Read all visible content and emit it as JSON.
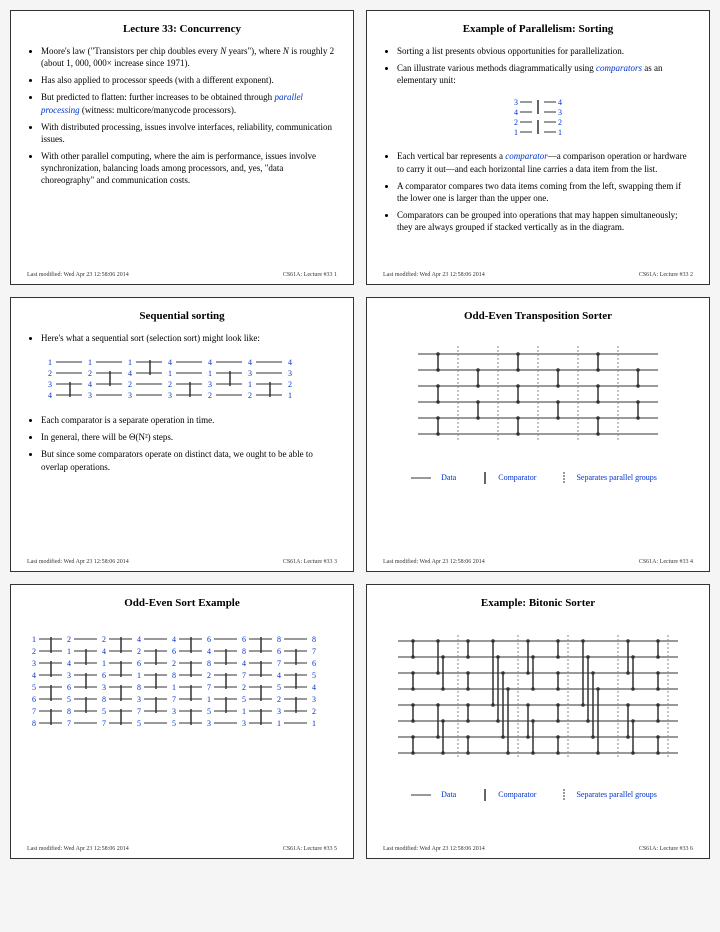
{
  "slides": [
    {
      "title": "Lecture 33: Concurrency",
      "footer_left": "Last modified: Wed Apr 23 12:58:06 2014",
      "footer_right": "CS61A: Lecture #33   1"
    },
    {
      "title": "Example of Parallelism: Sorting",
      "footer_left": "Last modified: Wed Apr 23 12:58:06 2014",
      "footer_right": "CS61A: Lecture #33   2"
    },
    {
      "title": "Sequential sorting",
      "footer_left": "Last modified: Wed Apr 23 12:58:06 2014",
      "footer_right": "CS61A: Lecture #33   3"
    },
    {
      "title": "Odd-Even Transposition Sorter",
      "footer_left": "Last modified: Wed Apr 23 12:58:06 2014",
      "footer_right": "CS61A: Lecture #33   4"
    },
    {
      "title": "Odd-Even Sort Example",
      "footer_left": "Last modified: Wed Apr 23 12:58:06 2014",
      "footer_right": "CS61A: Lecture #33   5"
    },
    {
      "title": "Example: Bitonic Sorter",
      "footer_left": "Last modified: Wed Apr 23 12:58:06 2014",
      "footer_right": "CS61A: Lecture #33   6"
    }
  ],
  "s1": {
    "b1a": "Moore's law (\"Transistors per chip doubles every ",
    "b1b": " years\"), where ",
    "b1c": " is roughly 2 (about ",
    "b1d": " increase since 1971).",
    "n1": "N",
    "n2": "N",
    "million": "1, 000, 000×",
    "b2": "Has also applied to processor speeds (with a different exponent).",
    "b3a": "But predicted to flatten: further increases to be obtained through ",
    "b3b": " (witness: multicore/manycode processors).",
    "link1": "parallel processing",
    "b4": "With distributed processing, issues involve interfaces, reliability, communication issues.",
    "b5": "With other parallel computing, where the aim is performance, issues involve synchronization, balancing loads among processors, and, yes, \"data choreography\" and communication costs."
  },
  "s2": {
    "b1": "Sorting a list presents obvious opportunities for parallelization.",
    "b2a": "Can illustrate various methods diagrammatically using ",
    "b2b": " as an elementary unit:",
    "link1": "comparators",
    "demo": [
      [
        "3",
        "4"
      ],
      [
        "4",
        "3"
      ],
      [
        "2",
        "2"
      ],
      [
        "1",
        "1"
      ]
    ],
    "b3a": "Each vertical bar represents a ",
    "b3b": "—a comparison operation or hardware to carry it out—and each horizontal line carries a data item from the list.",
    "link2": "comparator",
    "b4": "A comparator compares two data items coming from the left, swapping them if the lower one is larger than the upper one.",
    "b5": "Comparators can be grouped into operations that may happen simultaneously; they are always grouped if stacked vertically as in the diagram."
  },
  "s3": {
    "b1": "Here's what a sequential sort (selection sort) might look like:",
    "cols": [
      [
        "1",
        "2",
        "3",
        "4"
      ],
      [
        "1",
        "2",
        "4",
        "3"
      ],
      [
        "1",
        "4",
        "2",
        "3"
      ],
      [
        "4",
        "1",
        "2",
        "3"
      ],
      [
        "4",
        "1",
        "3",
        "2"
      ],
      [
        "4",
        "3",
        "1",
        "2"
      ],
      [
        "4",
        "3",
        "2",
        "1"
      ]
    ],
    "b2": "Each comparator is a separate operation in time.",
    "b3a": "In general, there will be ",
    "b3b": " steps.",
    "big": "Θ(N²)",
    "b4": "But since some comparators operate on distinct data, we ought to be able to overlap operations."
  },
  "s5": {
    "cols": [
      [
        "1",
        "2",
        "3",
        "4",
        "5",
        "6",
        "7",
        "8"
      ],
      [
        "2",
        "1",
        "4",
        "3",
        "6",
        "5",
        "8",
        "7"
      ],
      [
        "2",
        "4",
        "1",
        "6",
        "3",
        "8",
        "5",
        "7"
      ],
      [
        "4",
        "2",
        "6",
        "1",
        "8",
        "3",
        "7",
        "5"
      ],
      [
        "4",
        "6",
        "2",
        "8",
        "1",
        "7",
        "3",
        "5"
      ],
      [
        "6",
        "4",
        "8",
        "2",
        "7",
        "1",
        "5",
        "3"
      ],
      [
        "6",
        "8",
        "4",
        "7",
        "2",
        "5",
        "1",
        "3"
      ],
      [
        "8",
        "6",
        "7",
        "4",
        "5",
        "2",
        "3",
        "1"
      ],
      [
        "8",
        "7",
        "6",
        "5",
        "4",
        "3",
        "2",
        "1"
      ]
    ]
  },
  "legend": {
    "data": "Data",
    "comp": "Comparator",
    "sep": "Separates parallel groups"
  }
}
